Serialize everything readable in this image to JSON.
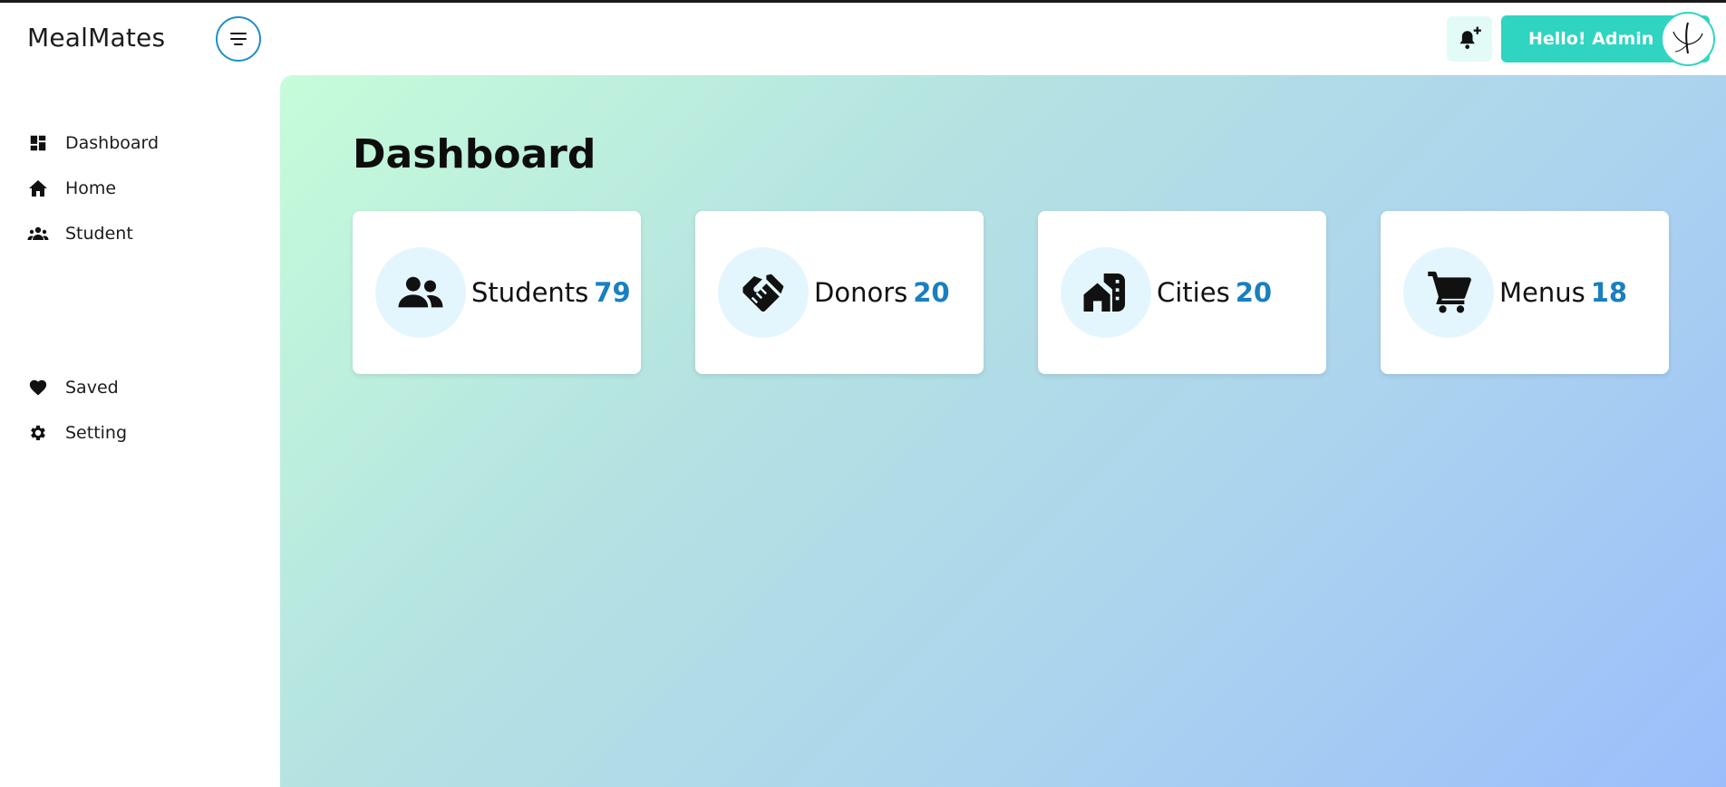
{
  "app": {
    "brand": "MealMates"
  },
  "header": {
    "greeting": "Hello! Admin"
  },
  "sidebar": {
    "items": [
      {
        "label": "Dashboard",
        "icon": "dashboard-icon"
      },
      {
        "label": "Home",
        "icon": "home-icon"
      },
      {
        "label": "Student",
        "icon": "group-icon"
      },
      {
        "label": "Saved",
        "icon": "heart-icon"
      },
      {
        "label": "Setting",
        "icon": "gear-icon"
      }
    ]
  },
  "main": {
    "title": "Dashboard",
    "cards": [
      {
        "label": "Students",
        "count": "79",
        "icon": "people-icon"
      },
      {
        "label": "Donors",
        "count": "20",
        "icon": "handshake-icon"
      },
      {
        "label": "Cities",
        "count": "20",
        "icon": "city-icon"
      },
      {
        "label": "Menus",
        "count": "18",
        "icon": "cart-icon"
      }
    ]
  },
  "colors": {
    "accent": "#2fd5c0",
    "count": "#1a7fbf",
    "toggle_border": "#1e8fc8"
  }
}
